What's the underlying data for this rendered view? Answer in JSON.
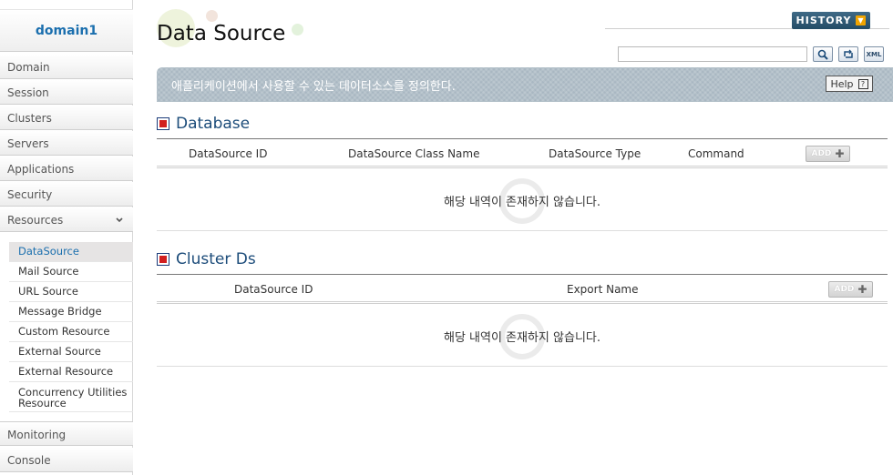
{
  "sidebar": {
    "domain": "domain1",
    "nav": [
      "Domain",
      "Session",
      "Clusters",
      "Servers",
      "Applications",
      "Security",
      "Resources"
    ],
    "resources_sub": [
      "DataSource",
      "Mail Source",
      "URL Source",
      "Message Bridge",
      "Custom Resource",
      "External Source",
      "External Resource",
      "Concurrency Utilities Resource"
    ],
    "bottom_nav": [
      "Monitoring",
      "Console"
    ],
    "expand_icon": "chevron-down-icon"
  },
  "header": {
    "title": "Data Source",
    "history_label": "HISTORY",
    "search_placeholder": "",
    "tool_icons": [
      "search-icon",
      "refresh-icon",
      "xml-icon"
    ]
  },
  "description": {
    "text": "애플리케이션에서 사용할 수 있는 데이터소스를 정의한다.",
    "help_label": "Help",
    "help_icon": "?"
  },
  "database": {
    "title": "Database",
    "columns": [
      "DataSource ID",
      "DataSource Class Name",
      "DataSource Type",
      "Command"
    ],
    "add_label": "ADD",
    "empty_text": "해당 내역이 존재하지 않습니다."
  },
  "cluster_ds": {
    "title": "Cluster Ds",
    "columns": [
      "DataSource ID",
      "Export Name"
    ],
    "add_label": "ADD",
    "empty_text": "해당 내역이 존재하지 않습니다."
  },
  "colors": {
    "accent": "#1b6fae",
    "section_title": "#1c4c7a",
    "desc_bar": "#a9b7c2",
    "history_btn": "#2d5a78"
  }
}
